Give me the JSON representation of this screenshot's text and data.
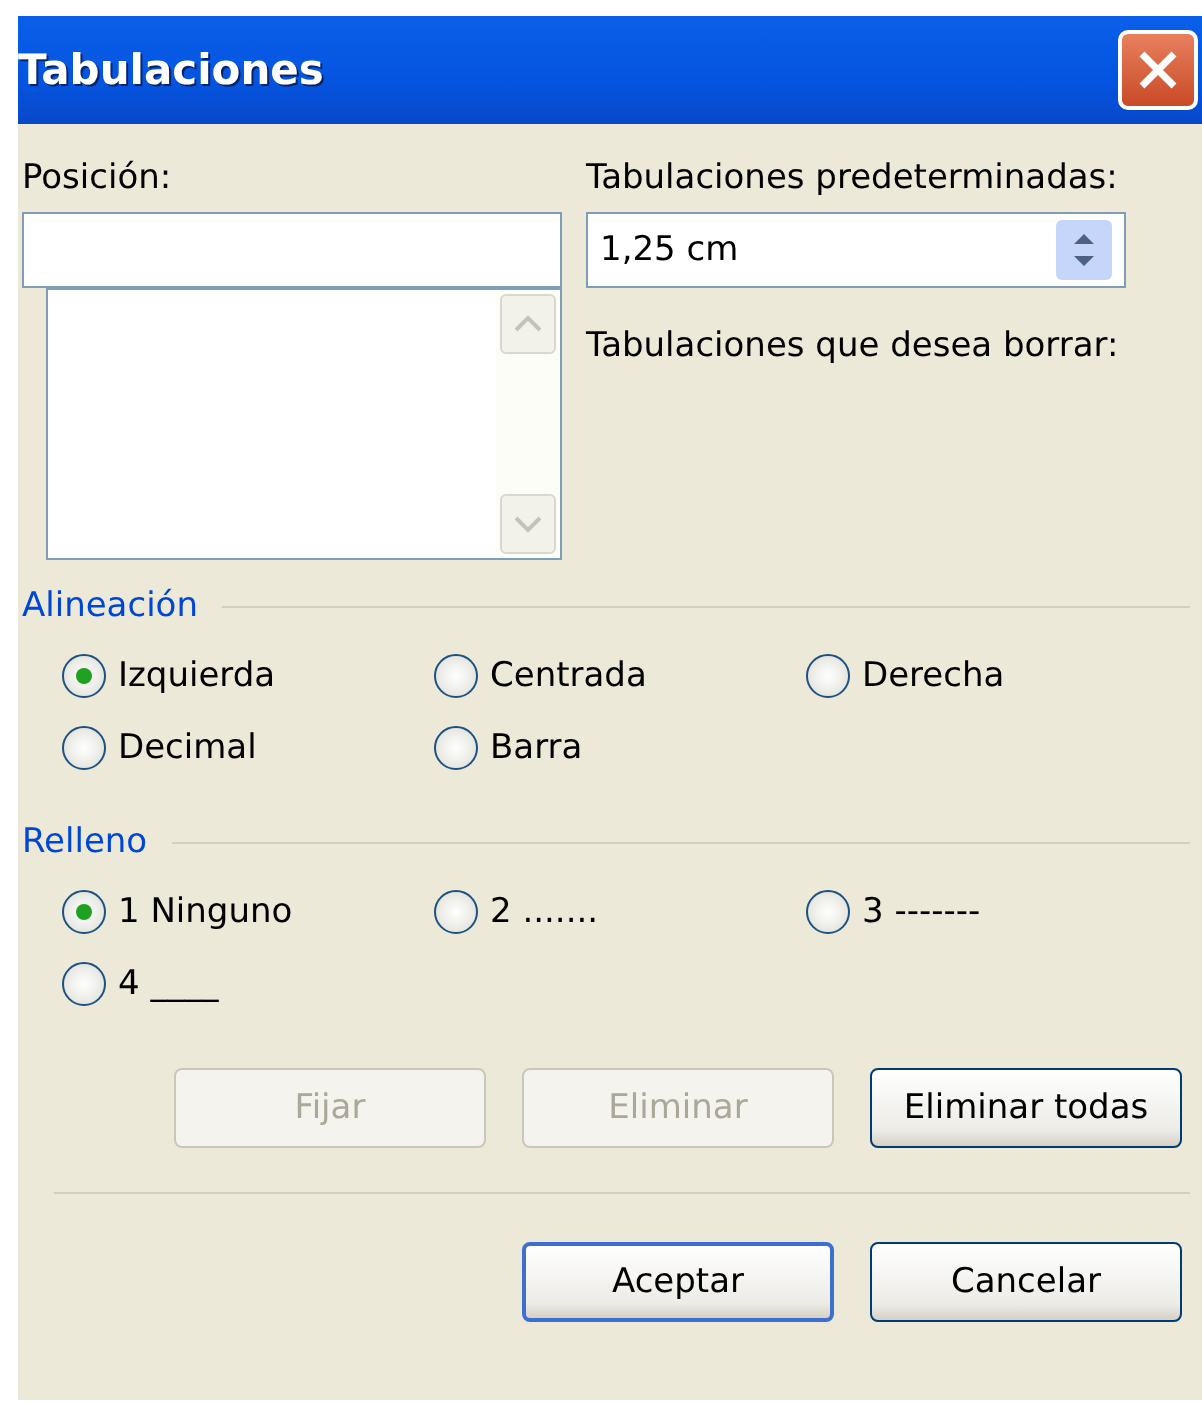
{
  "window": {
    "title": "Tabulaciones"
  },
  "position": {
    "label": "Posición:"
  },
  "defaults": {
    "label": "Tabulaciones predeterminadas:",
    "value": "1,25 cm"
  },
  "clear_label": "Tabulaciones que desea borrar:",
  "groups": [
    {
      "title": "Alineación",
      "options": [
        {
          "label": "Izquierda",
          "selected": true
        },
        {
          "label": "Centrada",
          "selected": false
        },
        {
          "label": "Derecha",
          "selected": false
        },
        {
          "label": "Decimal",
          "selected": false
        },
        {
          "label": "Barra",
          "selected": false
        }
      ]
    },
    {
      "title": "Relleno",
      "options": [
        {
          "label": "1 Ninguno",
          "selected": true
        },
        {
          "label": "2 .......",
          "selected": false
        },
        {
          "label": "3 -------",
          "selected": false
        },
        {
          "label": "4 ____",
          "selected": false
        }
      ]
    }
  ],
  "tab_buttons": [
    {
      "label": "Fijar",
      "disabled": true
    },
    {
      "label": "Eliminar",
      "disabled": true
    },
    {
      "label": "Eliminar todas",
      "disabled": false
    }
  ],
  "buttons": [
    {
      "label": "Aceptar",
      "default": true
    },
    {
      "label": "Cancelar",
      "default": false
    }
  ]
}
